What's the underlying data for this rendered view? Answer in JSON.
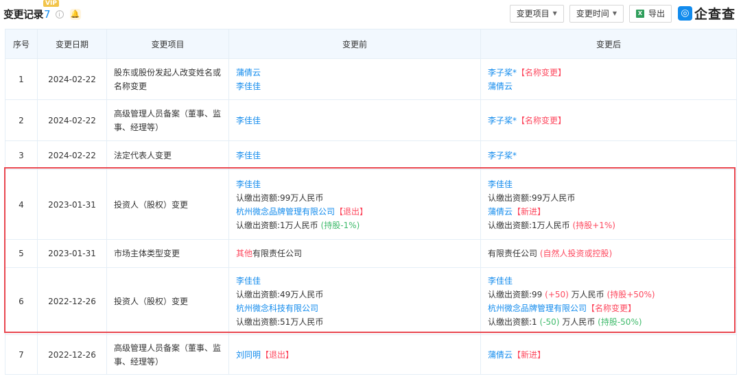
{
  "header": {
    "title": "变更记录",
    "count": "7",
    "vip_badge": "VIP",
    "info_icon": "info-icon",
    "bell_icon": "bell-icon",
    "filter_item": "变更项目",
    "filter_time": "变更时间",
    "export": "导出",
    "brand": "企查查"
  },
  "table": {
    "headers": [
      "序号",
      "变更日期",
      "变更项目",
      "变更前",
      "变更后"
    ],
    "rows": [
      {
        "no": "1",
        "date": "2024-02-22",
        "item": "股东或股份发起人改变姓名或名称变更",
        "before": [
          {
            "link": "蒲倩云"
          },
          {
            "link": "李佳佳"
          }
        ],
        "after": [
          {
            "link": "李子桨*",
            "tag": "【名称变更】"
          },
          {
            "link": "蒲倩云"
          }
        ]
      },
      {
        "no": "2",
        "date": "2024-02-22",
        "item": "高级管理人员备案（董事、监事、经理等）",
        "before": [
          {
            "link": "李佳佳"
          }
        ],
        "after": [
          {
            "link": "李子桨*",
            "tag": "【名称变更】"
          }
        ]
      },
      {
        "no": "3",
        "date": "2024-02-22",
        "item": "法定代表人变更",
        "before": [
          {
            "link": "李佳佳"
          }
        ],
        "after": [
          {
            "link": "李子桨*"
          }
        ]
      },
      {
        "no": "4",
        "date": "2023-01-31",
        "item": "投资人（股权）变更",
        "before": [
          {
            "link": "李佳佳"
          },
          {
            "text": "认缴出资额:99万人民币"
          },
          {
            "link": "杭州微念品牌管理有限公司",
            "tag": "【退出】"
          },
          {
            "text": "认缴出资额:1万人民币",
            "green": "(持股-1%)"
          }
        ],
        "after": [
          {
            "link": "李佳佳"
          },
          {
            "text": "认缴出资额:99万人民币"
          },
          {
            "link": "蒲倩云",
            "tag": "【新进】"
          },
          {
            "text": "认缴出资额:1万人民币",
            "red": "(持股+1%)"
          }
        ]
      },
      {
        "no": "5",
        "date": "2023-01-31",
        "item": "市场主体类型变更",
        "before": [
          {
            "red_pre": "其他",
            "text": "有限责任公司"
          }
        ],
        "after": [
          {
            "text": "有限责任公司",
            "red": "(自然人投资或控股)"
          }
        ]
      },
      {
        "no": "6",
        "date": "2022-12-26",
        "item": "投资人（股权）变更",
        "before": [
          {
            "link": "李佳佳"
          },
          {
            "text": "认缴出资额:49万人民币"
          },
          {
            "link": "杭州微念科技有限公司"
          },
          {
            "text": "认缴出资额:51万人民币"
          }
        ],
        "after": [
          {
            "link": "李佳佳"
          },
          {
            "text": "认缴出资额:99",
            "red_mid": "(+50)",
            "text2": "万人民币",
            "red": "(持股+50%)"
          },
          {
            "link": "杭州微念品牌管理有限公司",
            "tag": "【名称变更】"
          },
          {
            "text": "认缴出资额:1",
            "green_mid": "(-50)",
            "text2": "万人民币",
            "green": "(持股-50%)"
          }
        ]
      },
      {
        "no": "7",
        "date": "2022-12-26",
        "item": "高级管理人员备案（董事、监事、经理等）",
        "before": [
          {
            "link": "刘同明",
            "tag": "【退出】"
          }
        ],
        "after": [
          {
            "link": "蒲倩云",
            "tag": "【新进】"
          }
        ]
      }
    ]
  },
  "colors": {
    "accent": "#128bed",
    "tag_red": "#fd485e",
    "green": "#3fba6b",
    "header_bg": "#f2f8fe",
    "highlight_border": "#e8454e"
  }
}
